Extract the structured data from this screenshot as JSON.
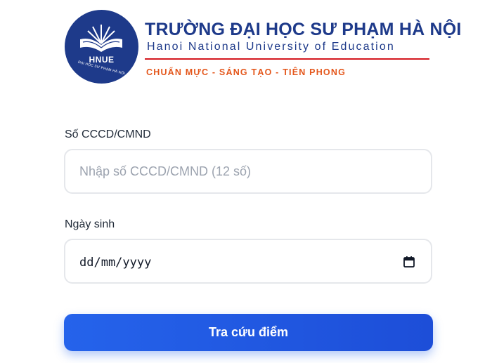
{
  "header": {
    "logo_abbr": "HNUE",
    "logo_ring_text": "ĐẠI HỌC SƯ PHẠM HÀ NỘI",
    "university_name_vi": "TRƯỜNG ĐẠI HỌC SƯ PHẠM HÀ NỘI",
    "university_name_en": "Hanoi National University of Education",
    "motto": "CHUẨN MỰC - SÁNG TẠO - TIÊN PHONG",
    "colors": {
      "navy": "#1e3a8a",
      "red_rule": "#d4181f",
      "motto_orange": "#e4571c"
    }
  },
  "form": {
    "id_field": {
      "label": "Số CCCD/CMND",
      "placeholder": "Nhập số CCCD/CMND (12 số)",
      "value": ""
    },
    "dob_field": {
      "label": "Ngày sinh",
      "value_display": "dd/mm/yyyy",
      "icon": "calendar-icon"
    },
    "submit_label": "Tra cứu điểm",
    "accent_color": "#2563eb"
  }
}
